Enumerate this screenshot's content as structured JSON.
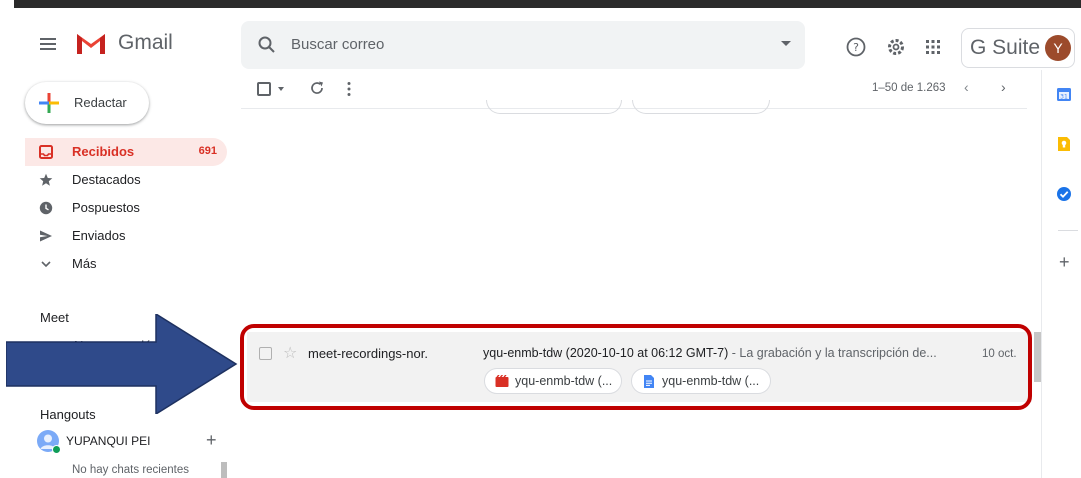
{
  "app": {
    "name": "Gmail",
    "suite": "G Suite",
    "avatar_letter": "Y"
  },
  "search": {
    "placeholder": "Buscar correo"
  },
  "compose": {
    "label": "Redactar"
  },
  "nav": [
    {
      "label": "Recibidos",
      "count": "691",
      "icon": "inbox-icon",
      "active": true
    },
    {
      "label": "Destacados",
      "icon": "star-icon"
    },
    {
      "label": "Pospuestos",
      "icon": "clock-icon"
    },
    {
      "label": "Enviados",
      "icon": "send-icon"
    },
    {
      "label": "Más",
      "icon": "chevron-down-icon"
    }
  ],
  "meet": {
    "title": "Meet",
    "new_meeting": "Nueva reunión"
  },
  "hangouts": {
    "title": "Hangouts",
    "user": "YUPANQUI PEI",
    "empty": "No hay chats recientes"
  },
  "toolbar": {
    "range": "1–50 de 1.263"
  },
  "email": {
    "sender": "meet-recordings-nor.",
    "subject": "yqu-enmb-tdw (2020-10-10 at 06:12 GMT-7)",
    "snippet": " - La grabación y la transcripción de...",
    "date": "10 oct.",
    "attachments": [
      {
        "label": "yqu-enmb-tdw (...",
        "icon": "video-file-icon",
        "color": "#d93025"
      },
      {
        "label": "yqu-enmb-tdw (...",
        "icon": "doc-file-icon",
        "color": "#4285f4"
      }
    ]
  },
  "colors": {
    "highlight": "#c00000",
    "arrow": "#2f4a8a",
    "accent": "#d93025"
  }
}
